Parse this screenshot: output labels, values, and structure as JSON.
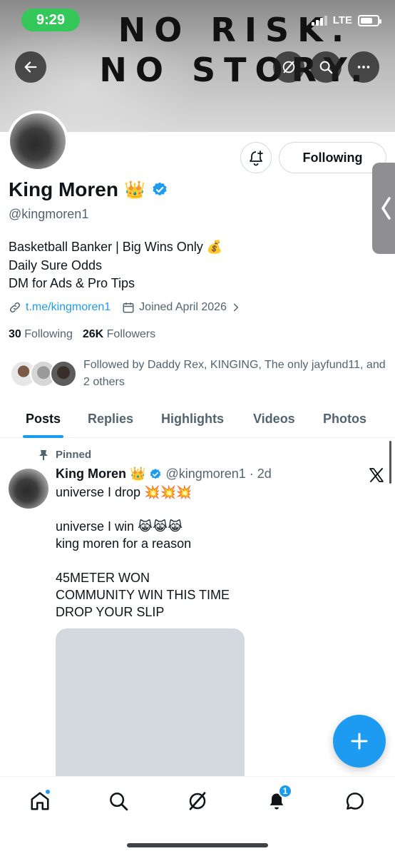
{
  "status_bar": {
    "time": "9:29",
    "network": "LTE"
  },
  "banner": {
    "line1": "NO RISK.",
    "line2": "NO STORY."
  },
  "profile": {
    "name": "King Moren",
    "name_emoji": "👑",
    "handle": "@kingmoren1",
    "follow_state": "Following",
    "bio": [
      "Basketball Banker | Big Wins Only 💰",
      "Daily Sure Odds",
      "DM for Ads & Pro Tips"
    ],
    "link": "t.me/kingmoren1",
    "joined": "Joined April 2026",
    "following_count": "30",
    "following_label": "Following",
    "followers_count": "26K",
    "followers_label": "Followers",
    "followed_by": "Followed by Daddy Rex, KINGING, The only jayfund11, and 2 others"
  },
  "tabs": [
    "Posts",
    "Replies",
    "Highlights",
    "Videos",
    "Photos"
  ],
  "post": {
    "pinned_label": "Pinned",
    "author": "King Moren",
    "author_emoji": "👑",
    "handle": "@kingmoren1",
    "time": "2d",
    "text": "universe I drop 💥💥💥\n\nuniverse I win 😹😹😹\nking moren for a reason\n\n45METER WON\nCOMMUNITY WIN THIS TIME\nDROP YOUR SLIP"
  },
  "nav": {
    "notifications_badge": "1"
  },
  "colors": {
    "accent": "#1d9bf0",
    "status_green": "#34c759",
    "text_primary": "#0f1419",
    "text_secondary": "#536471"
  }
}
